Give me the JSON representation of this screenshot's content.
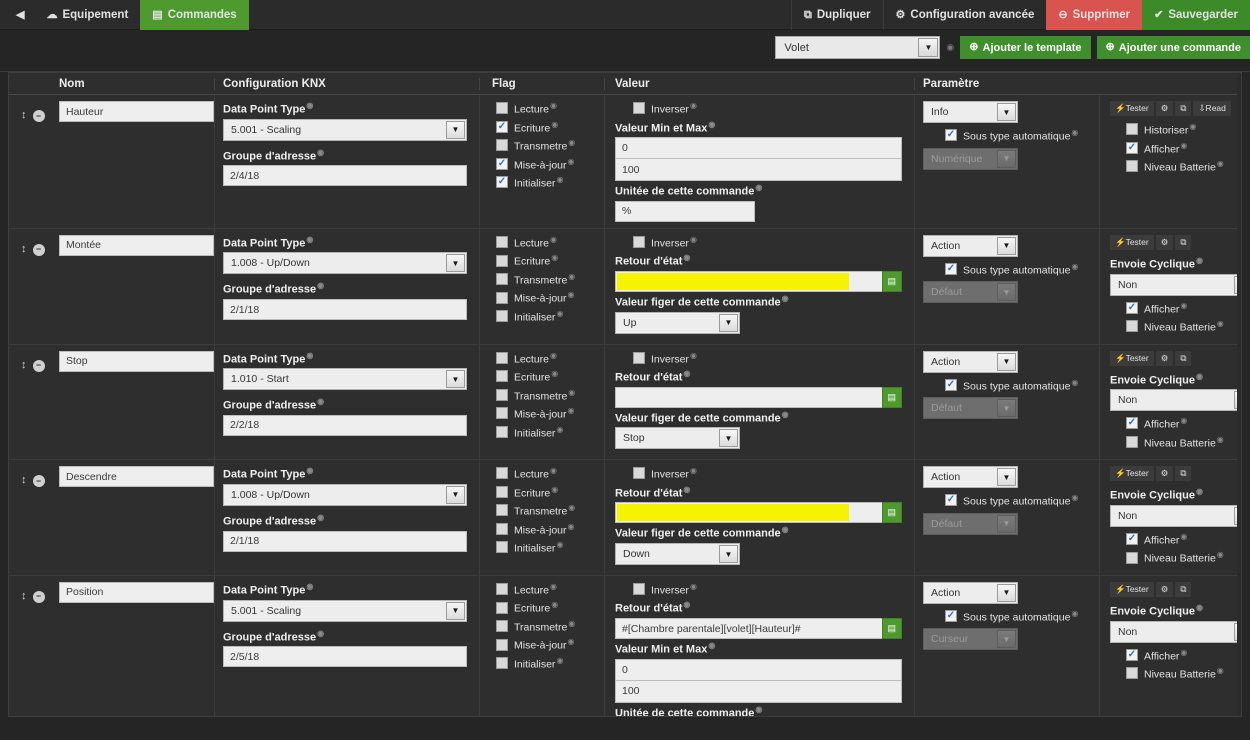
{
  "topbar": {
    "back_icon": "back-arrow-icon",
    "tabs": [
      {
        "label": "Equipement",
        "icon": "cloud-icon",
        "active": false
      },
      {
        "label": "Commandes",
        "icon": "list-icon",
        "active": true
      }
    ],
    "actions": [
      {
        "label": "Dupliquer",
        "icon": "copy-icon",
        "style": "plain"
      },
      {
        "label": "Configuration avancée",
        "icon": "gears-icon",
        "style": "plain"
      },
      {
        "label": "Supprimer",
        "icon": "minus-circle-icon",
        "style": "red"
      },
      {
        "label": "Sauvegarder",
        "icon": "check-circle-icon",
        "style": "green"
      }
    ]
  },
  "actionstrip": {
    "template_value": "Volet",
    "add_template_label": "Ajouter le template",
    "add_command_label": "Ajouter une commande",
    "plus_icon": "plus-circle-icon"
  },
  "columns": {
    "nom": "Nom",
    "knx": "Configuration KNX",
    "flag": "Flag",
    "valeur": "Valeur",
    "parametre": "Paramètre",
    "actions": ""
  },
  "labels": {
    "dpt": "Data Point Type",
    "groupe": "Groupe d'adresse",
    "inverser": "Inverser",
    "valeur_min_max": "Valeur Min et Max",
    "unitee": "Unitée de cette commande",
    "retour_etat": "Retour d'état",
    "valeur_figer": "Valeur figer de cette commande",
    "sous_type_auto": "Sous type automatique",
    "envoie_cyclique": "Envoie Cyclique",
    "historiser": "Historiser",
    "afficher": "Afficher",
    "niveau_batterie": "Niveau Batterie",
    "flags": [
      "Lecture",
      "Ecriture",
      "Transmetre",
      "Mise-à-jour",
      "Initialiser"
    ],
    "mini_buttons": [
      "Tester",
      "Read"
    ],
    "mini_icons": [
      "gear-icon",
      "copy-icon"
    ]
  },
  "colors": {
    "green": "#4e9a2f",
    "red": "#d9534f",
    "highlight": "#f5f300",
    "panel": "#2e2e2e"
  },
  "rows": [
    {
      "name": "Hauteur",
      "dpt": "5.001 - Scaling",
      "groupe": "2/4/18",
      "flags": [
        false,
        true,
        false,
        true,
        true
      ],
      "inverser": false,
      "value_kind": "minmax",
      "min": "0",
      "max": "100",
      "unit": "%",
      "retour": "",
      "retour_highlight": false,
      "figer": "",
      "param_type": "Info",
      "sous_type_auto": true,
      "sub_type": "Numérique",
      "has_cyclique": false,
      "cyclique": "",
      "historiser": false,
      "afficher": true,
      "niveau_batterie": false,
      "has_read_button": true
    },
    {
      "name": "Montée",
      "dpt": "1.008 - Up/Down",
      "groupe": "2/1/18",
      "flags": [
        false,
        false,
        false,
        false,
        false
      ],
      "inverser": false,
      "value_kind": "retour",
      "min": "",
      "max": "",
      "unit": "",
      "retour": "",
      "retour_highlight": true,
      "figer": "Up",
      "param_type": "Action",
      "sous_type_auto": true,
      "sub_type": "Défaut",
      "has_cyclique": true,
      "cyclique": "Non",
      "historiser": null,
      "afficher": true,
      "niveau_batterie": false,
      "has_read_button": false
    },
    {
      "name": "Stop",
      "dpt": "1.010 - Start",
      "groupe": "2/2/18",
      "flags": [
        false,
        false,
        false,
        false,
        false
      ],
      "inverser": false,
      "value_kind": "retour",
      "min": "",
      "max": "",
      "unit": "",
      "retour": "",
      "retour_highlight": false,
      "figer": "Stop",
      "param_type": "Action",
      "sous_type_auto": true,
      "sub_type": "Défaut",
      "has_cyclique": true,
      "cyclique": "Non",
      "historiser": null,
      "afficher": true,
      "niveau_batterie": false,
      "has_read_button": false
    },
    {
      "name": "Descendre",
      "dpt": "1.008 - Up/Down",
      "groupe": "2/1/18",
      "flags": [
        false,
        false,
        false,
        false,
        false
      ],
      "inverser": false,
      "value_kind": "retour",
      "min": "",
      "max": "",
      "unit": "",
      "retour": "",
      "retour_highlight": true,
      "figer": "Down",
      "param_type": "Action",
      "sous_type_auto": true,
      "sub_type": "Défaut",
      "has_cyclique": true,
      "cyclique": "Non",
      "historiser": null,
      "afficher": true,
      "niveau_batterie": false,
      "has_read_button": false
    },
    {
      "name": "Position",
      "dpt": "5.001 - Scaling",
      "groupe": "2/5/18",
      "flags": [
        false,
        false,
        false,
        false,
        false
      ],
      "inverser": false,
      "value_kind": "retour_minmax",
      "min": "0",
      "max": "100",
      "unit": "",
      "retour": "#[Chambre parentale][volet][Hauteur]#",
      "retour_highlight": false,
      "figer": "",
      "param_type": "Action",
      "sous_type_auto": true,
      "sub_type": "Curseur",
      "has_cyclique": true,
      "cyclique": "Non",
      "historiser": null,
      "afficher": true,
      "niveau_batterie": false,
      "has_read_button": false
    }
  ]
}
